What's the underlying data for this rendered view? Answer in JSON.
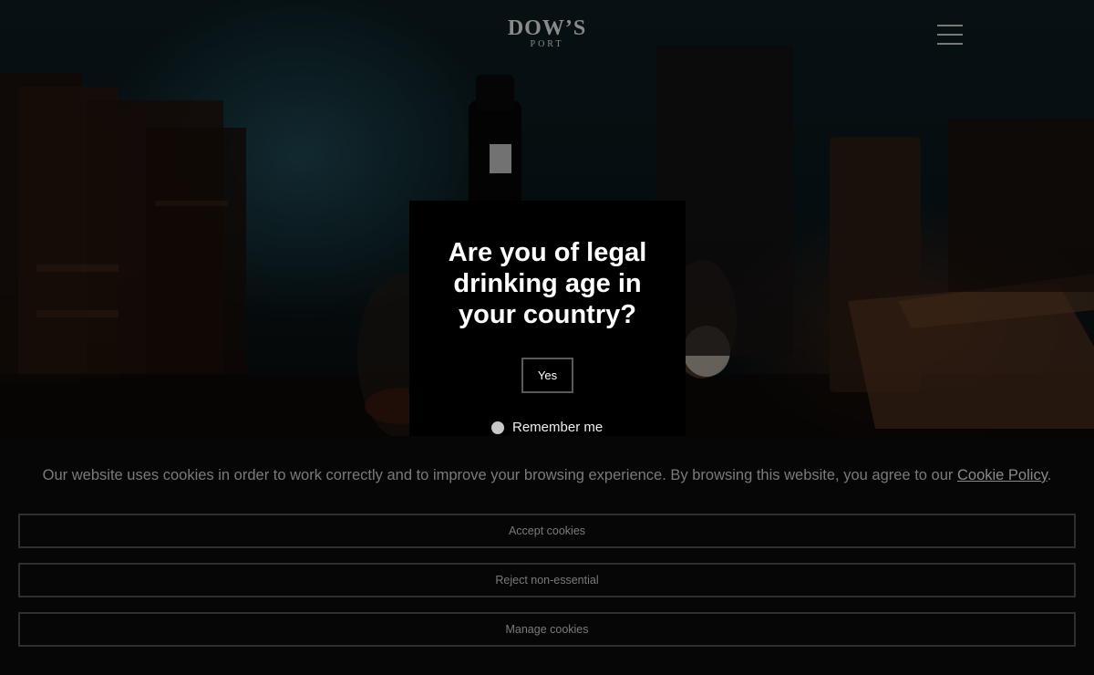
{
  "header": {
    "logo_main": "DOW’S",
    "logo_sub": "PORT",
    "menu_icon": "hamburger-menu-icon"
  },
  "age_gate": {
    "question": "Are you of legal drinking age in your country?",
    "yes_label": "Yes",
    "remember_label": "Remember me"
  },
  "cookie_banner": {
    "message": "Our website uses cookies in order to work correctly and to improve your browsing experience. By browsing this website, you agree to our",
    "link_label": "Cookie Policy",
    "trailing": ".",
    "accept_label": "Accept cookies",
    "reject_label": "Reject non-essential",
    "manage_label": "Manage cookies"
  },
  "colors": {
    "background": "#060606",
    "modal_bg": "#000000",
    "text_muted": "#7a7a7a"
  }
}
